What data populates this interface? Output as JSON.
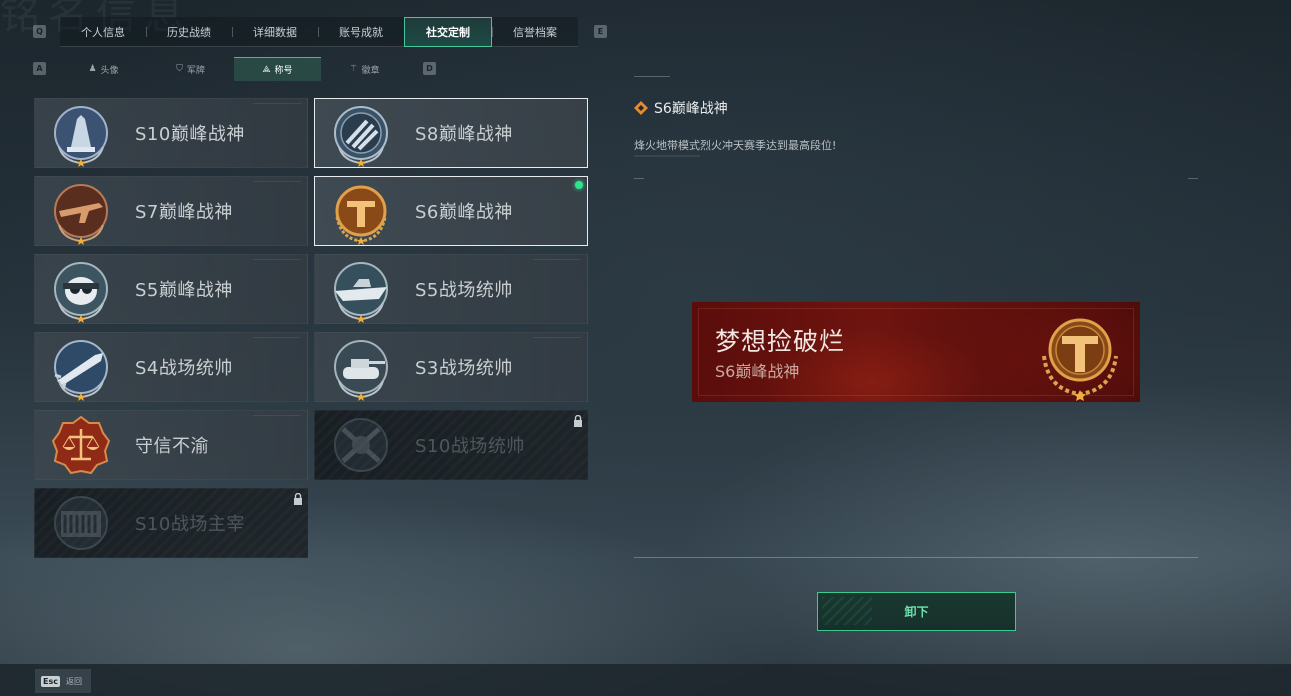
{
  "background_title": "铭名信息",
  "main_tabs": {
    "prev_key": "Q",
    "next_key": "E",
    "items": [
      {
        "label": "个人信息"
      },
      {
        "label": "历史战绩"
      },
      {
        "label": "详细数据"
      },
      {
        "label": "账号成就"
      },
      {
        "label": "社交定制",
        "active": true
      },
      {
        "label": "信誉档案"
      }
    ]
  },
  "sub_tabs": {
    "prev_key": "A",
    "next_key": "D",
    "items": [
      {
        "label": "头像",
        "icon": "person-icon"
      },
      {
        "label": "军牌",
        "icon": "dogtag-icon"
      },
      {
        "label": "称号",
        "icon": "title-icon",
        "active": true
      },
      {
        "label": "徽章",
        "icon": "emblem-icon"
      }
    ]
  },
  "titles": [
    {
      "name": "S10巅峰战神",
      "badge": "blue-tower-emblem",
      "state": "normal"
    },
    {
      "name": "S8巅峰战神",
      "badge": "slash-disc-emblem",
      "state": "selected"
    },
    {
      "name": "S7巅峰战神",
      "badge": "rifle-emblem",
      "state": "normal"
    },
    {
      "name": "S6巅峰战神",
      "badge": "gold-t-emblem",
      "state": "selected",
      "equipped": true
    },
    {
      "name": "S5巅峰战神",
      "badge": "diver-skull-emblem",
      "state": "normal"
    },
    {
      "name": "S5战场统帅",
      "badge": "boat-emblem",
      "state": "normal"
    },
    {
      "name": "S4战场统帅",
      "badge": "missile-emblem",
      "state": "normal"
    },
    {
      "name": "S3战场统帅",
      "badge": "tank-emblem",
      "state": "normal"
    },
    {
      "name": "守信不渝",
      "badge": "scales-emblem",
      "state": "normal"
    },
    {
      "name": "S10战场统帅",
      "badge": "crossed-gear-emblem",
      "state": "locked"
    },
    {
      "name": "S10战场主宰",
      "badge": "colosseum-emblem",
      "state": "locked"
    }
  ],
  "detail": {
    "title": "S6巅峰战神",
    "description": "烽火地带模式烈火冲天赛季达到最高段位!",
    "banner_nickname": "梦想捡破烂",
    "banner_title": "S6巅峰战神",
    "action_label": "卸下"
  },
  "footer": {
    "esc_key": "Esc",
    "esc_label": "返回"
  },
  "colors": {
    "accent": "#3ec98e",
    "equipped_dot": "#2fe38f",
    "banner_red": "#6e1410",
    "gold": "#c78a3a"
  }
}
